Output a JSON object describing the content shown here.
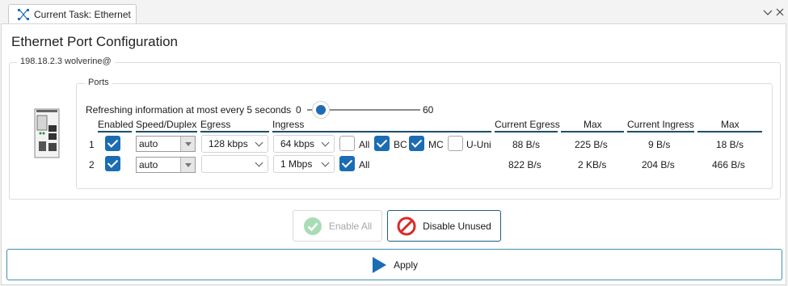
{
  "tab": {
    "label": "Current Task: Ethernet",
    "icon": "network-task-icon"
  },
  "window_controls": [
    "chevron-down-icon",
    "close-icon"
  ],
  "page": {
    "title": "Ethernet Port Configuration"
  },
  "device_group": {
    "legend": "198.18.2.3 wolverine@",
    "image": "device-hardware-icon"
  },
  "ports_group": {
    "legend": "Ports"
  },
  "refresh": {
    "label": "Refreshing information at most every 5 seconds",
    "min": "0",
    "max": "60",
    "value": 5
  },
  "headers": {
    "enabled": "Enabled",
    "speed_duplex": "Speed/Duplex",
    "egress": "Egress",
    "ingress": "Ingress",
    "current_egress": "Current Egress",
    "max_egress": "Max",
    "current_ingress": "Current Ingress",
    "max_ingress": "Max"
  },
  "rows": [
    {
      "port": "1",
      "enabled": true,
      "speed": "auto",
      "egress": "128 kbps",
      "ingress": "64 kbps",
      "ingress_all": {
        "label": "All",
        "checked": false
      },
      "ingress_bc": {
        "label": "BC",
        "checked": true
      },
      "ingress_mc": {
        "label": "MC",
        "checked": true
      },
      "ingress_uuni": {
        "label": "U-Uni",
        "checked": false
      },
      "current_egress": "88 B/s",
      "max_egress": "225 B/s",
      "current_ingress": "9 B/s",
      "max_ingress": "18 B/s"
    },
    {
      "port": "2",
      "enabled": true,
      "speed": "auto",
      "egress": "",
      "ingress": "1 Mbps",
      "ingress_all": {
        "label": "All",
        "checked": true
      },
      "current_egress": "822 B/s",
      "max_egress": "2 KB/s",
      "current_ingress": "204 B/s",
      "max_ingress": "466 B/s"
    }
  ],
  "buttons": {
    "enable_all": {
      "label": "Enable All",
      "enabled": false,
      "icon": "check-circle-icon"
    },
    "disable_unused": {
      "label": "Disable Unused",
      "enabled": true,
      "icon": "no-entry-icon"
    },
    "apply": {
      "label": "Apply",
      "icon": "play-icon"
    }
  },
  "colors": {
    "accent": "#1b6cb3",
    "header_rule": "#1f4e6b",
    "danger": "#d92a2a",
    "success": "#8fd19e"
  }
}
